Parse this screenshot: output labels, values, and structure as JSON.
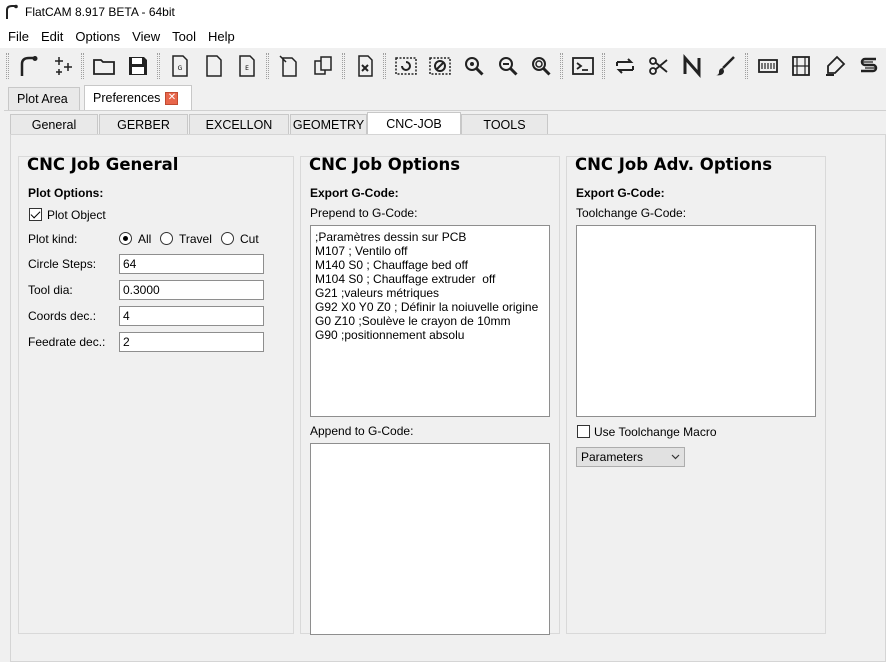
{
  "window": {
    "title": "FlatCAM 8.917 BETA - 64bit"
  },
  "menu": [
    "File",
    "Edit",
    "Options",
    "View",
    "Tool",
    "Help"
  ],
  "doc_tabs": {
    "plot_area": "Plot Area",
    "preferences": "Preferences",
    "close_glyph": "✕"
  },
  "pref_tabs": [
    "General",
    "GERBER",
    "EXCELLON",
    "GEOMETRY",
    "CNC-JOB",
    "TOOLS"
  ],
  "active_pref_tab": "CNC-JOB",
  "general": {
    "title": "CNC Job General",
    "plot_options": "Plot Options:",
    "plot_object": "Plot Object",
    "plot_object_checked": true,
    "plot_kind_label": "Plot kind:",
    "plot_kind_options": [
      "All",
      "Travel",
      "Cut"
    ],
    "plot_kind_selected": "All",
    "circle_steps_label": "Circle Steps:",
    "circle_steps": "64",
    "tool_dia_label": "Tool dia:",
    "tool_dia": "0.3000",
    "coords_dec_label": "Coords dec.:",
    "coords_dec": "4",
    "feedrate_dec_label": "Feedrate dec.:",
    "feedrate_dec": "2"
  },
  "options": {
    "title": "CNC Job Options",
    "export_label": "Export G-Code:",
    "prepend_label": "Prepend to G-Code:",
    "prepend_lines": [
      ";Paramètres dessin sur PCB",
      "M107 ; Ventilo off",
      "M140 S0 ; Chauffage bed off",
      "M104 S0 ; Chauffage extruder  off",
      "G21 ;valeurs métriques",
      "G92 X0 Y0 Z0 ; Définir la noiuvelle origine",
      "G0 Z10 ;Soulève le crayon de 10mm",
      "G90 ;positionnement absolu"
    ],
    "append_label": "Append to G-Code:"
  },
  "adv": {
    "title": "CNC Job Adv. Options",
    "export_label": "Export G-Code:",
    "toolchange_label": "Toolchange G-Code:",
    "use_macro_label": "Use Toolchange Macro",
    "use_macro_checked": false,
    "macro_select_value": "Parameters"
  },
  "toolbar_icons": [
    "app-logo-icon",
    "snap-grid-icon",
    "open-folder-icon",
    "save-icon",
    "new-gerber-icon",
    "new-file-icon",
    "new-excellon-icon",
    "open-project-icon",
    "copy-object-icon",
    "delete-icon",
    "replot-icon",
    "clear-plot-icon",
    "zoom-fit-icon",
    "zoom-in-icon",
    "zoom-out-icon",
    "shell-icon",
    "flip-icon",
    "cutout-icon",
    "ncc-icon",
    "paint-icon",
    "panel-icon",
    "film-icon",
    "solder-paste-icon",
    "substract-icon"
  ],
  "colors": {
    "accent_close": "#e8664b",
    "background": "#f0f0f0"
  }
}
